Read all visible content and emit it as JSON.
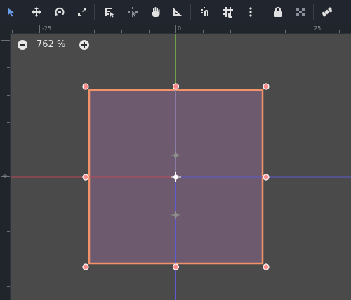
{
  "toolbar": {
    "tools": [
      {
        "name": "select-mode-tool-icon",
        "active": true
      },
      {
        "name": "move-mode-tool-icon"
      },
      {
        "name": "rotate-mode-tool-icon"
      },
      {
        "name": "scale-mode-tool-icon"
      },
      {
        "name": "list-selection-tool-icon"
      },
      {
        "name": "edit-pivot-tool-icon"
      },
      {
        "name": "pan-mode-tool-icon"
      },
      {
        "name": "ruler-mode-tool-icon"
      },
      {
        "name": "smart-snap-toggle-icon"
      },
      {
        "name": "grid-snap-toggle-icon"
      },
      {
        "name": "snap-options-menu-icon"
      },
      {
        "name": "lock-icon"
      },
      {
        "name": "group-icon"
      },
      {
        "name": "bone-icon"
      }
    ]
  },
  "ruler": {
    "top_labels": [
      "-25",
      "0",
      "25"
    ],
    "left_labels": [
      "0"
    ]
  },
  "zoom": {
    "level": "762 %",
    "zoom_out_icon": "minus-circle-icon",
    "zoom_in_icon": "plus-circle-icon"
  },
  "colors": {
    "toolbar_bg": "#21262e",
    "canvas_bg": "#4a4a4a",
    "accent_active": "#699ce8",
    "selection_outline": "#f2926b",
    "selection_fill": "#6e5a6f",
    "handle_fill": "#ff8a8a",
    "x_axis": "#b84b5a",
    "y_axis": "#6ca049",
    "blue_axis": "#5f5acd"
  }
}
